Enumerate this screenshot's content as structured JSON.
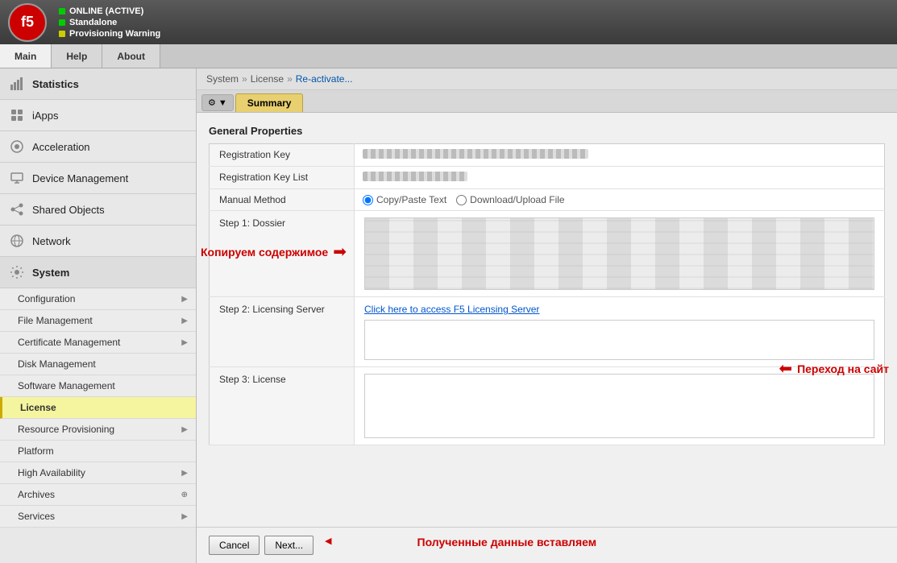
{
  "header": {
    "logo_text": "f5",
    "status_lines": [
      {
        "label": "ONLINE (ACTIVE)",
        "dot": "green"
      },
      {
        "label": "Standalone",
        "dot": "green"
      },
      {
        "label": "Provisioning Warning",
        "dot": "yellow"
      }
    ]
  },
  "nav_tabs": [
    {
      "id": "main",
      "label": "Main",
      "active": true
    },
    {
      "id": "help",
      "label": "Help"
    },
    {
      "id": "about",
      "label": "About"
    }
  ],
  "sidebar": {
    "items": [
      {
        "id": "statistics",
        "label": "Statistics",
        "icon": "📊"
      },
      {
        "id": "iapps",
        "label": "iApps",
        "icon": "🔲"
      },
      {
        "id": "acceleration",
        "label": "Acceleration",
        "icon": "⚡"
      },
      {
        "id": "device-management",
        "label": "Device Management",
        "icon": "🖥"
      },
      {
        "id": "shared-objects",
        "label": "Shared Objects",
        "icon": "🔗"
      },
      {
        "id": "network",
        "label": "Network",
        "icon": "🌐"
      }
    ],
    "system": {
      "label": "System",
      "icon": "⚙",
      "submenu": [
        {
          "id": "configuration",
          "label": "Configuration",
          "has_arrow": true
        },
        {
          "id": "file-management",
          "label": "File Management",
          "has_arrow": true
        },
        {
          "id": "certificate-management",
          "label": "Certificate Management",
          "has_arrow": true
        },
        {
          "id": "disk-management",
          "label": "Disk Management",
          "has_arrow": false
        },
        {
          "id": "software-management",
          "label": "Software Management",
          "has_arrow": false
        },
        {
          "id": "license",
          "label": "License",
          "active": true,
          "has_arrow": false
        },
        {
          "id": "resource-provisioning",
          "label": "Resource Provisioning",
          "has_arrow": true
        },
        {
          "id": "platform",
          "label": "Platform",
          "has_arrow": false
        },
        {
          "id": "high-availability",
          "label": "High Availability",
          "has_arrow": true
        },
        {
          "id": "archives",
          "label": "Archives",
          "has_arrow": true
        },
        {
          "id": "services",
          "label": "Services",
          "has_arrow": true
        }
      ]
    }
  },
  "breadcrumb": {
    "parts": [
      "System",
      "License",
      "Re-activate..."
    ]
  },
  "tabs": {
    "gear_label": "⚙ ▼",
    "items": [
      {
        "id": "summary",
        "label": "Summary",
        "active": true
      }
    ]
  },
  "form": {
    "section_title": "General Properties",
    "fields": [
      {
        "label": "Registration Key",
        "type": "blurred-long"
      },
      {
        "label": "Registration Key List",
        "type": "blurred-medium"
      },
      {
        "label": "Manual Method",
        "type": "radio"
      }
    ],
    "radio_options": [
      "Copy/Paste Text",
      "Download/Upload File"
    ],
    "radio_selected": "Copy/Paste Text",
    "steps": [
      {
        "id": "step1",
        "label": "Step 1: Dossier",
        "type": "textarea-blurred"
      },
      {
        "id": "step2",
        "label": "Step 2: Licensing Server",
        "link_text": "Click here to access F5 Licensing Server",
        "type": "link+textarea"
      },
      {
        "id": "step3",
        "label": "Step 3: License",
        "type": "textarea-empty"
      }
    ]
  },
  "buttons": [
    {
      "id": "cancel",
      "label": "Cancel"
    },
    {
      "id": "next",
      "label": "Next..."
    }
  ],
  "annotations": [
    {
      "id": "copy-label",
      "text": "Копируем содержимое"
    },
    {
      "id": "goto-label",
      "text": "Переход на сайт"
    },
    {
      "id": "paste-label",
      "text": "Полученные данные вставляем"
    }
  ]
}
